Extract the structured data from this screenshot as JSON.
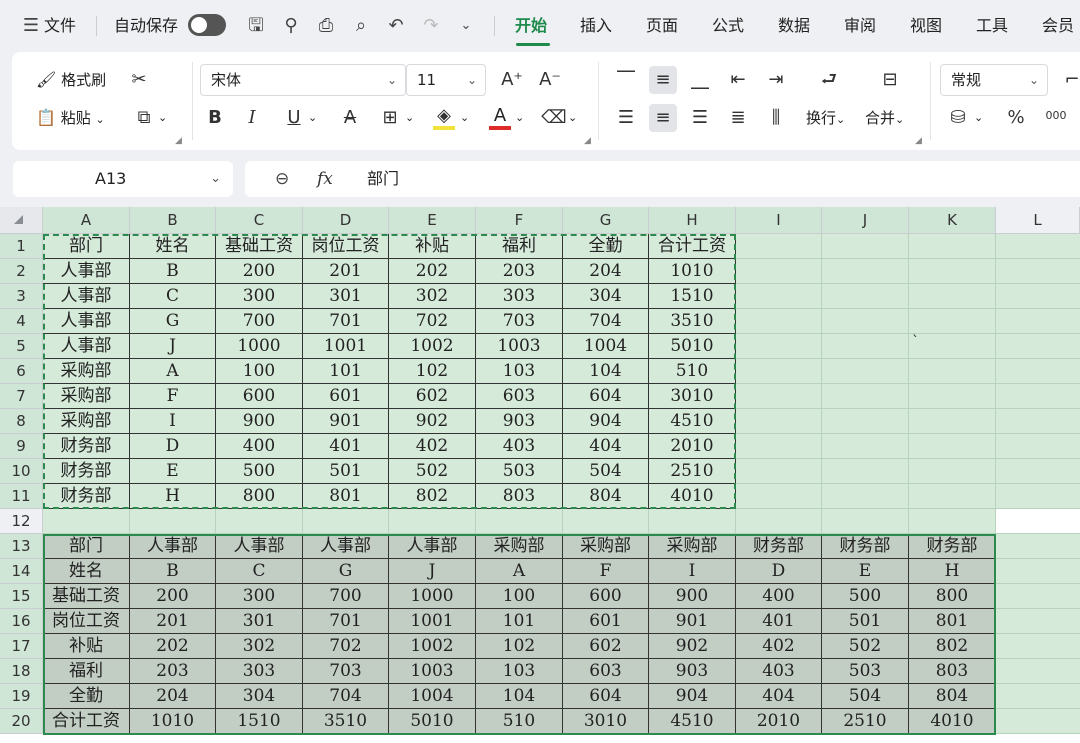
{
  "menubar": {
    "hamburger_icon": "menu-icon",
    "file": "文件",
    "autosave": "自动保存",
    "tabs": [
      "开始",
      "插入",
      "页面",
      "公式",
      "数据",
      "审阅",
      "视图",
      "工具",
      "会员"
    ]
  },
  "ribbon": {
    "format_painter": "格式刷",
    "paste": "粘贴",
    "font_name": "宋体",
    "font_size": "11",
    "wrap_text": "换行",
    "merge": "合并",
    "number_format": "常规",
    "bold": "B",
    "italic": "I",
    "underline": "U",
    "strike": "A",
    "percent": "%",
    "thousands": "000",
    "font_color": "#e02b2b",
    "fill_color": "#f2e23a"
  },
  "formula_bar": {
    "name_box": "A13",
    "fx": "fx",
    "content": "部门"
  },
  "columns": [
    "A",
    "B",
    "C",
    "D",
    "E",
    "F",
    "G",
    "H",
    "I",
    "J",
    "K",
    "L"
  ],
  "rows": [
    "1",
    "2",
    "3",
    "4",
    "5",
    "6",
    "7",
    "8",
    "9",
    "10",
    "11",
    "12",
    "13",
    "14",
    "15",
    "16",
    "17",
    "18",
    "19",
    "20"
  ],
  "table1": [
    [
      "部门",
      "姓名",
      "基础工资",
      "岗位工资",
      "补贴",
      "福利",
      "全勤",
      "合计工资"
    ],
    [
      "人事部",
      "B",
      "200",
      "201",
      "202",
      "203",
      "204",
      "1010"
    ],
    [
      "人事部",
      "C",
      "300",
      "301",
      "302",
      "303",
      "304",
      "1510"
    ],
    [
      "人事部",
      "G",
      "700",
      "701",
      "702",
      "703",
      "704",
      "3510"
    ],
    [
      "人事部",
      "J",
      "1000",
      "1001",
      "1002",
      "1003",
      "1004",
      "5010"
    ],
    [
      "采购部",
      "A",
      "100",
      "101",
      "102",
      "103",
      "104",
      "510"
    ],
    [
      "采购部",
      "F",
      "600",
      "601",
      "602",
      "603",
      "604",
      "3010"
    ],
    [
      "采购部",
      "I",
      "900",
      "901",
      "902",
      "903",
      "904",
      "4510"
    ],
    [
      "财务部",
      "D",
      "400",
      "401",
      "402",
      "403",
      "404",
      "2010"
    ],
    [
      "财务部",
      "E",
      "500",
      "501",
      "502",
      "503",
      "504",
      "2510"
    ],
    [
      "财务部",
      "H",
      "800",
      "801",
      "802",
      "803",
      "804",
      "4010"
    ]
  ],
  "table2": [
    [
      "部门",
      "人事部",
      "人事部",
      "人事部",
      "人事部",
      "采购部",
      "采购部",
      "采购部",
      "财务部",
      "财务部",
      "财务部"
    ],
    [
      "姓名",
      "B",
      "C",
      "G",
      "J",
      "A",
      "F",
      "I",
      "D",
      "E",
      "H"
    ],
    [
      "基础工资",
      "200",
      "300",
      "700",
      "1000",
      "100",
      "600",
      "900",
      "400",
      "500",
      "800"
    ],
    [
      "岗位工资",
      "201",
      "301",
      "701",
      "1001",
      "101",
      "601",
      "901",
      "401",
      "501",
      "801"
    ],
    [
      "补贴",
      "202",
      "302",
      "702",
      "1002",
      "102",
      "602",
      "902",
      "402",
      "502",
      "802"
    ],
    [
      "福利",
      "203",
      "303",
      "703",
      "1003",
      "103",
      "603",
      "903",
      "403",
      "503",
      "803"
    ],
    [
      "全勤",
      "204",
      "304",
      "704",
      "1004",
      "104",
      "604",
      "904",
      "404",
      "504",
      "804"
    ],
    [
      "合计工资",
      "1010",
      "1510",
      "3510",
      "5010",
      "510",
      "3010",
      "4510",
      "2010",
      "2510",
      "4010"
    ]
  ],
  "stray_mark": "`",
  "colors": {
    "accent": "#1e8a4c",
    "selection": "#d5ead9",
    "marquee": "#2c8a4f"
  }
}
